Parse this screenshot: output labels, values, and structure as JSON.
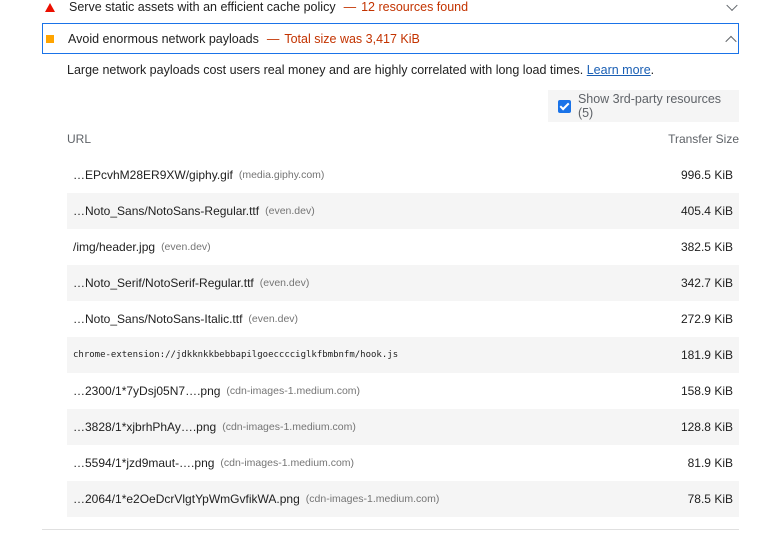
{
  "audits": [
    {
      "title": "Serve static assets with an efficient cache policy",
      "sep": "—",
      "display": "12 resources found"
    },
    {
      "title": "Avoid enormous network payloads",
      "sep": "—",
      "display": "Total size was 3,417 KiB"
    }
  ],
  "description": {
    "text": "Large network payloads cost users real money and are highly correlated with long load times.",
    "link": "Learn more",
    "end": "."
  },
  "filter": {
    "label": "Show 3rd-party resources (5)"
  },
  "table": {
    "headers": {
      "url": "URL",
      "size": "Transfer Size"
    },
    "rows": [
      {
        "url": "…EPcvhM28ER9XW/giphy.gif",
        "host": "(media.giphy.com)",
        "size": "996.5 KiB"
      },
      {
        "url": "…Noto_Sans/NotoSans-Regular.ttf",
        "host": "(even.dev)",
        "size": "405.4 KiB"
      },
      {
        "url": "/img/header.jpg",
        "host": "(even.dev)",
        "size": "382.5 KiB"
      },
      {
        "url": "…Noto_Serif/NotoSerif-Regular.ttf",
        "host": "(even.dev)",
        "size": "342.7 KiB"
      },
      {
        "url": "…Noto_Sans/NotoSans-Italic.ttf",
        "host": "(even.dev)",
        "size": "272.9 KiB"
      },
      {
        "url": "chrome-extension://jdkknkkbebbapilgoecccciglkfbmbnfm/hook.js",
        "host": "",
        "size": "181.9 KiB"
      },
      {
        "url": "…2300/1*7yDsj05N7….png",
        "host": "(cdn-images-1.medium.com)",
        "size": "158.9 KiB"
      },
      {
        "url": "…3828/1*xjbrhPhAy….png",
        "host": "(cdn-images-1.medium.com)",
        "size": "128.8 KiB"
      },
      {
        "url": "…5594/1*jzd9maut-….png",
        "host": "(cdn-images-1.medium.com)",
        "size": "81.9 KiB"
      },
      {
        "url": "…2064/1*e2OeDcrVlgtYpWmGvfikWA.png",
        "host": "(cdn-images-1.medium.com)",
        "size": "78.5 KiB"
      }
    ]
  },
  "colors": {
    "fail": "#eb0f00",
    "average": "#ffa400",
    "accent": "#1a73e8"
  }
}
